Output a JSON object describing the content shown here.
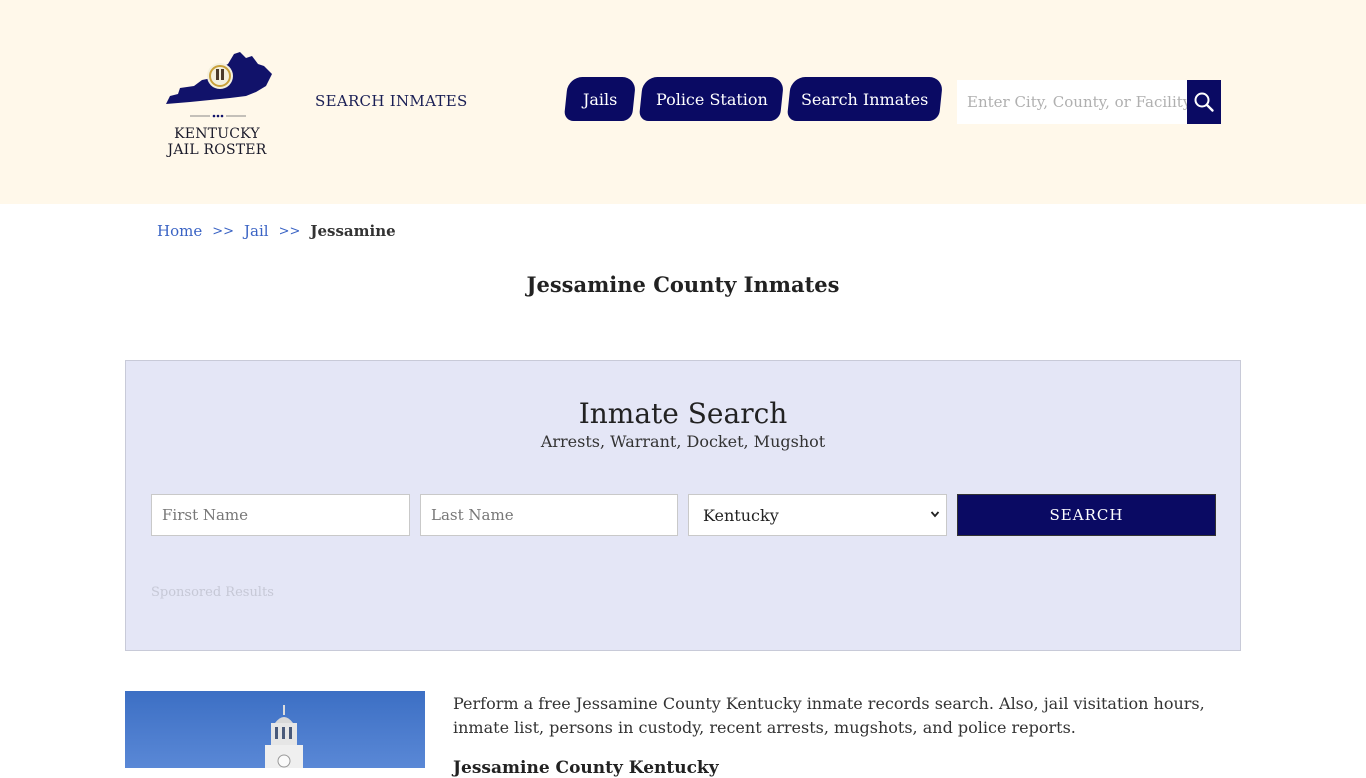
{
  "header": {
    "logo_line1": "KENTUCKY",
    "logo_line2": "JAIL ROSTER",
    "logo_icon": "kentucky-state-seal-icon",
    "link_label": "SEARCH INMATES",
    "nav": [
      {
        "label": "Jails"
      },
      {
        "label": "Police Station"
      },
      {
        "label": "Search Inmates"
      }
    ],
    "search_placeholder": "Enter City, County, or Facility",
    "search_icon": "search-icon"
  },
  "breadcrumb": {
    "items": [
      "Home",
      "Jail",
      "Jessamine"
    ],
    "separator": ">>"
  },
  "page": {
    "title": "Jessamine County Inmates"
  },
  "inmate_search": {
    "title": "Inmate Search",
    "subtitle": "Arrests, Warrant, Docket, Mugshot",
    "first_name_placeholder": "First Name",
    "last_name_placeholder": "Last Name",
    "state_value": "Kentucky",
    "button_label": "SEARCH",
    "sponsored_label": "Sponsored Results"
  },
  "content": {
    "intro": "Perform a free Jessamine County Kentucky inmate records search. Also, jail visitation hours, inmate list, persons in custody, recent arrests, mugshots, and police reports.",
    "sub_heading": "Jessamine County Kentucky"
  },
  "colors": {
    "header_bg": "#fff8ea",
    "accent_navy": "#0a0a63",
    "panel_bg": "#e4e6f6",
    "link_blue": "#3a63c4"
  }
}
